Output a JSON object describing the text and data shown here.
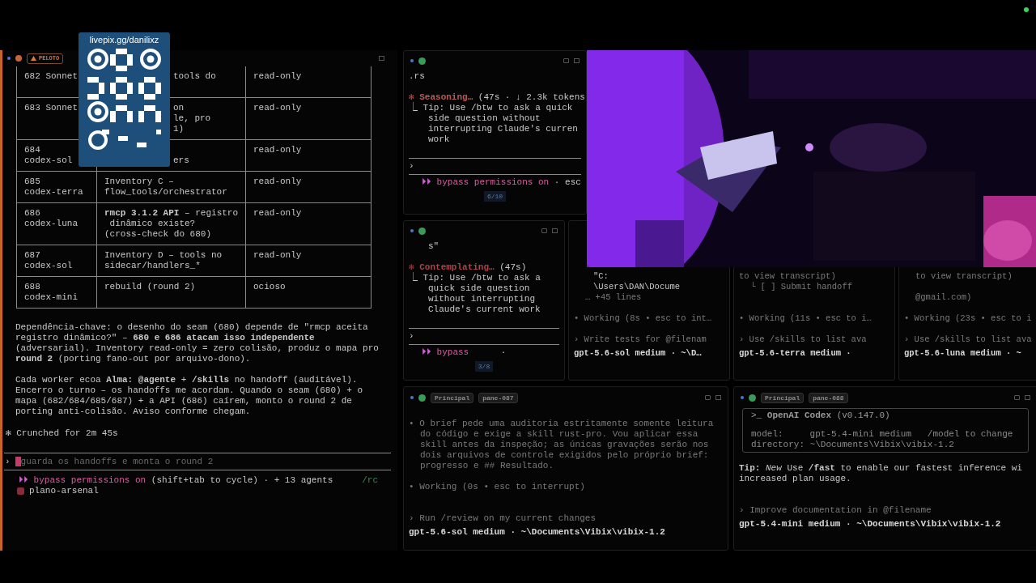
{
  "overlay": {
    "link": "livepix.gg/danilixz"
  },
  "left_pane": {
    "badge": "PELOTO",
    "table": {
      "rows": [
        {
          "covered": true,
          "cells": [
            [
              "682 Sonnet"
            ],
            [
              "tools do"
            ],
            [
              "read-only"
            ]
          ]
        },
        {
          "covered": true,
          "cells": [
            [
              "683 Sonnet"
            ],
            [
              "on",
              "le, pro",
              "1)"
            ],
            [
              "read-only"
            ]
          ]
        },
        {
          "covered": true,
          "cells": [
            [
              "684",
              "codex-sol"
            ],
            [
              "",
              "ers"
            ],
            [
              "read-only"
            ]
          ]
        },
        {
          "covered": false,
          "cells": [
            [
              "685",
              "codex-terra"
            ],
            [
              "Inventory C –",
              "flow_tools/orchestrator"
            ],
            [
              "read-only"
            ]
          ]
        },
        {
          "covered": false,
          "cells": [
            [
              "686",
              "codex-luna"
            ],
            [
              "**rmcp 3.1.2 API** – registro",
              " dinâmico existe?",
              "(cross-check do 680)"
            ],
            [
              "read-only"
            ]
          ]
        },
        {
          "covered": false,
          "cells": [
            [
              "687",
              "codex-sol"
            ],
            [
              "Inventory D – tools no",
              "sidecar/handlers_*"
            ],
            [
              "read-only"
            ]
          ]
        },
        {
          "covered": false,
          "cells": [
            [
              "688",
              "codex-mini"
            ],
            [
              "rebuild (round 2)"
            ],
            [
              "ocioso"
            ]
          ]
        }
      ]
    },
    "paragraphs": [
      "Dependência-chave: o desenho do seam (680) depende de \"rmcp aceita registro dinâmico?\" – **680 e 686 atacam isso independente** (adversarial). Inventory read-only = zero colisão, produz o mapa pro **round 2** (porting fano-out por arquivo-dono).",
      "Cada worker ecoa **Alma:** **@agente** + **/skills** no handoff (auditável). Encerro o turno – os handoffs me acordam. Quando o seam (680) + o mapa (682/684/685/687) + a API (686) caírem, monto o round 2 de porting anti-colisão. Aviso conforme chegam."
    ],
    "status": {
      "icon": "✻",
      "text": "Crunched for 2m 45s"
    },
    "input": {
      "caret": "›",
      "placeholder": "guarda os handoffs e monta o round 2"
    },
    "mode": {
      "icon": "⏵⏵",
      "label": "bypass permissions on",
      "hint": "(shift+tab to cycle) · + 13 agents",
      "command": "/rc"
    },
    "branch": "plano-arsenal"
  },
  "middle_top": {
    "lines": [
      {
        "kind": "text",
        "text": ".rs"
      },
      {
        "kind": "gap"
      },
      {
        "kind": "spinner",
        "icon": "✻",
        "label": "Seasoning…",
        "detail": " (47s · ↓ 2.3k tokens",
        "color": "#b85a5a"
      },
      {
        "kind": "text",
        "text": "⎿ Tip: Use /btw to ask a quick"
      },
      {
        "kind": "indent",
        "text": "side question without"
      },
      {
        "kind": "indent",
        "text": "interrupting Claude's curren"
      },
      {
        "kind": "indent",
        "text": "work"
      },
      {
        "kind": "gap"
      },
      {
        "kind": "rule"
      },
      {
        "kind": "prompt",
        "caret": "›"
      },
      {
        "kind": "rule"
      },
      {
        "kind": "mode",
        "icon": "⏵⏵",
        "label": "bypass permissions on",
        "detail": " · esc"
      },
      {
        "kind": "status",
        "text": "6/10"
      }
    ]
  },
  "middle_bottom": {
    "lines": [
      {
        "kind": "indent",
        "text": "s\""
      },
      {
        "kind": "gap"
      },
      {
        "kind": "spinner",
        "icon": "✻",
        "label": "Contemplating…",
        "detail": " (47s)",
        "color": "#a8434e"
      },
      {
        "kind": "text",
        "text": "⎿ Tip: Use /btw to ask a"
      },
      {
        "kind": "indent",
        "text": "quick side question"
      },
      {
        "kind": "indent",
        "text": "without interrupting"
      },
      {
        "kind": "indent",
        "text": "Claude's current work"
      },
      {
        "kind": "gap"
      },
      {
        "kind": "rule"
      },
      {
        "kind": "prompt",
        "caret": "›"
      },
      {
        "kind": "rule"
      },
      {
        "kind": "mode",
        "icon": "⏵⏵",
        "label": "bypass",
        "detail": "      ·"
      },
      {
        "kind": "status",
        "text": "3/8"
      }
    ]
  },
  "small_panes": [
    {
      "lines": [
        {
          "kind": "indent",
          "text": "\"C:"
        },
        {
          "kind": "indent",
          "text": "\\Users\\DAN\\Docume"
        },
        {
          "kind": "dimindent",
          "text": "… +45 lines"
        },
        {
          "kind": "gap"
        },
        {
          "kind": "dim",
          "text": "• Working (8s • esc to int…"
        },
        {
          "kind": "gap"
        },
        {
          "kind": "dim",
          "text": "› Write tests for @filenam"
        },
        {
          "kind": "footer",
          "text": "gpt-5.6-sol medium · ~\\D…"
        }
      ]
    },
    {
      "lines": [
        {
          "kind": "dim",
          "text": "to view transcript)"
        },
        {
          "kind": "dimindent",
          "text": "└ [ ] Submit handoff"
        },
        {
          "kind": "gap"
        },
        {
          "kind": "gap"
        },
        {
          "kind": "dim",
          "text": "• Working (11s • esc to i…"
        },
        {
          "kind": "gap"
        },
        {
          "kind": "dim",
          "text": "› Use /skills to list ava"
        },
        {
          "kind": "footer",
          "text": "gpt-5.6-terra medium ·"
        }
      ]
    },
    {
      "lines": [
        {
          "kind": "dimindent",
          "text": "to view transcript)"
        },
        {
          "kind": "gap"
        },
        {
          "kind": "dimindent",
          "text": "@gmail.com)"
        },
        {
          "kind": "gap"
        },
        {
          "kind": "dim",
          "text": "• Working (23s • esc to i"
        },
        {
          "kind": "gap"
        },
        {
          "kind": "dim",
          "text": "› Use /skills to list ava"
        },
        {
          "kind": "footer",
          "text": "gpt-5.6-luna medium · ~"
        }
      ]
    }
  ],
  "bottom_panes": [
    {
      "tabs": [
        "Principal",
        "pane-087"
      ],
      "lines": [
        {
          "kind": "gap"
        },
        {
          "kind": "dim",
          "text": "• O brief pede uma auditoria estritamente somente leitura"
        },
        {
          "kind": "dimindent",
          "text": "do código e exige a skill rust-pro. Vou aplicar essa"
        },
        {
          "kind": "dimindent",
          "text": "skill antes da inspeção; as únicas gravações serão nos"
        },
        {
          "kind": "dimindent",
          "text": "dois arquivos de controle exigidos pelo próprio brief:"
        },
        {
          "kind": "dimindent",
          "text": "progresso e ## Resultado."
        },
        {
          "kind": "gap"
        },
        {
          "kind": "dim",
          "text": "• Working (0s • esc to interrupt)"
        },
        {
          "kind": "gap"
        },
        {
          "kind": "gap"
        },
        {
          "kind": "dim",
          "text": "› Run /review on my current changes"
        },
        {
          "kind": "footer",
          "text": "gpt-5.6-sol medium · ~\\Documents\\Vibix\\vibix-1.2"
        }
      ]
    },
    {
      "tabs": [
        "Principal",
        "pane-088"
      ],
      "lines": [
        {
          "kind": "boxed",
          "title": ">_ **OpenAI Codex** (v0.147.0)",
          "rows": [
            "model:     gpt-5.4-mini medium   /model to change",
            "directory: ~\\Documents\\Vibix\\vibix-1.2"
          ]
        },
        {
          "kind": "gap"
        },
        {
          "kind": "text",
          "text": "**Tip:** *New* Use **/fast** to enable our fastest inference wi"
        },
        {
          "kind": "text",
          "text": "increased plan usage."
        },
        {
          "kind": "gap"
        },
        {
          "kind": "gap"
        },
        {
          "kind": "dim",
          "text": "› Improve documentation in @filename"
        },
        {
          "kind": "footer",
          "text": "gpt-5.4-mini medium · ~\\Documents\\Vibix\\vibix-1.2"
        }
      ]
    }
  ]
}
